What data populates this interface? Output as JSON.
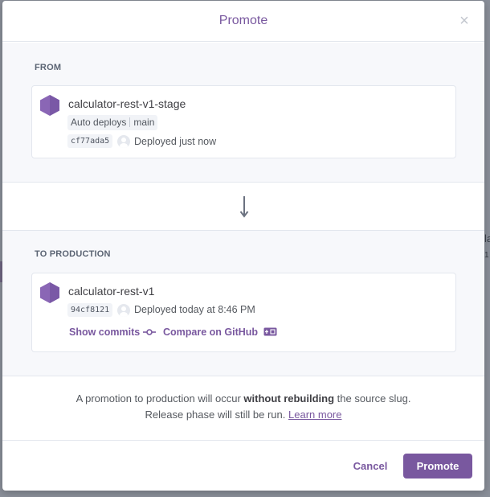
{
  "modal": {
    "title": "Promote",
    "close_icon": "close-icon"
  },
  "from": {
    "label": "FROM",
    "app_name": "calculator-rest-v1-stage",
    "auto_deploys_label": "Auto deploys",
    "branch": "main",
    "commit_sha": "cf77ada5",
    "deploy_status": "Deployed just now"
  },
  "to": {
    "label": "TO PRODUCTION",
    "app_name": "calculator-rest-v1",
    "commit_sha": "94cf8121",
    "deploy_status": "Deployed today at 8:46 PM",
    "show_commits_label": "Show commits",
    "compare_label": "Compare on GitHub"
  },
  "note": {
    "line1_before": "A promotion to production will occur ",
    "line1_bold": "without rebuilding",
    "line1_after": " the source slug.",
    "line2": "Release phase will still be run. ",
    "learn_more": "Learn more"
  },
  "footer": {
    "cancel_label": "Cancel",
    "promote_label": "Promote"
  },
  "colors": {
    "accent": "#79589f",
    "hex_icon": "#8a66b5"
  },
  "background": {
    "partial_text_1": "la",
    "partial_text_2": "1"
  }
}
